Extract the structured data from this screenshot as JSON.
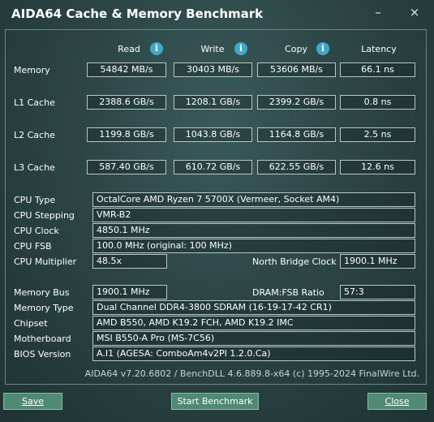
{
  "window": {
    "title": "AIDA64 Cache & Memory Benchmark",
    "minimize_glyph": "–",
    "close_glyph": "×"
  },
  "headers": {
    "read": "Read",
    "write": "Write",
    "copy": "Copy",
    "latency": "Latency",
    "info_glyph": "i"
  },
  "rows": [
    {
      "label": "Memory",
      "read": "54842 MB/s",
      "write": "30403 MB/s",
      "copy": "53606 MB/s",
      "latency": "66.1 ns"
    },
    {
      "label": "L1 Cache",
      "read": "2388.6 GB/s",
      "write": "1208.1 GB/s",
      "copy": "2399.2 GB/s",
      "latency": "0.8 ns"
    },
    {
      "label": "L2 Cache",
      "read": "1199.8 GB/s",
      "write": "1043.8 GB/s",
      "copy": "1164.8 GB/s",
      "latency": "2.5 ns"
    },
    {
      "label": "L3 Cache",
      "read": "587.40 GB/s",
      "write": "610.72 GB/s",
      "copy": "622.55 GB/s",
      "latency": "12.6 ns"
    }
  ],
  "cpu": {
    "type_label": "CPU Type",
    "type": "OctalCore AMD Ryzen 7 5700X  (Vermeer, Socket AM4)",
    "stepping_label": "CPU Stepping",
    "stepping": "VMR-B2",
    "clock_label": "CPU Clock",
    "clock": "4850.1 MHz",
    "fsb_label": "CPU FSB",
    "fsb": "100.0 MHz  (original: 100 MHz)",
    "multiplier_label": "CPU Multiplier",
    "multiplier": "48.5x",
    "nb_clock_label": "North Bridge Clock",
    "nb_clock": "1900.1 MHz"
  },
  "memory": {
    "bus_label": "Memory Bus",
    "bus": "1900.1 MHz",
    "ratio_label": "DRAM:FSB Ratio",
    "ratio": "57:3",
    "type_label": "Memory Type",
    "type": "Dual Channel DDR4-3800 SDRAM  (16-19-17-42 CR1)",
    "chipset_label": "Chipset",
    "chipset": "AMD B550, AMD K19.2 FCH, AMD K19.2 IMC",
    "motherboard_label": "Motherboard",
    "motherboard": "MSI B550-A Pro (MS-7C56)",
    "bios_label": "BIOS Version",
    "bios": "A.I1  (AGESA: ComboAm4v2PI 1.2.0.Ca)"
  },
  "footer": {
    "version": "AIDA64 v7.20.6802 / BenchDLL 4.6.889.8-x64  (c) 1995-2024 FinalWire Ltd."
  },
  "buttons": {
    "save": "Save",
    "start": "Start Benchmark",
    "close": "Close"
  }
}
